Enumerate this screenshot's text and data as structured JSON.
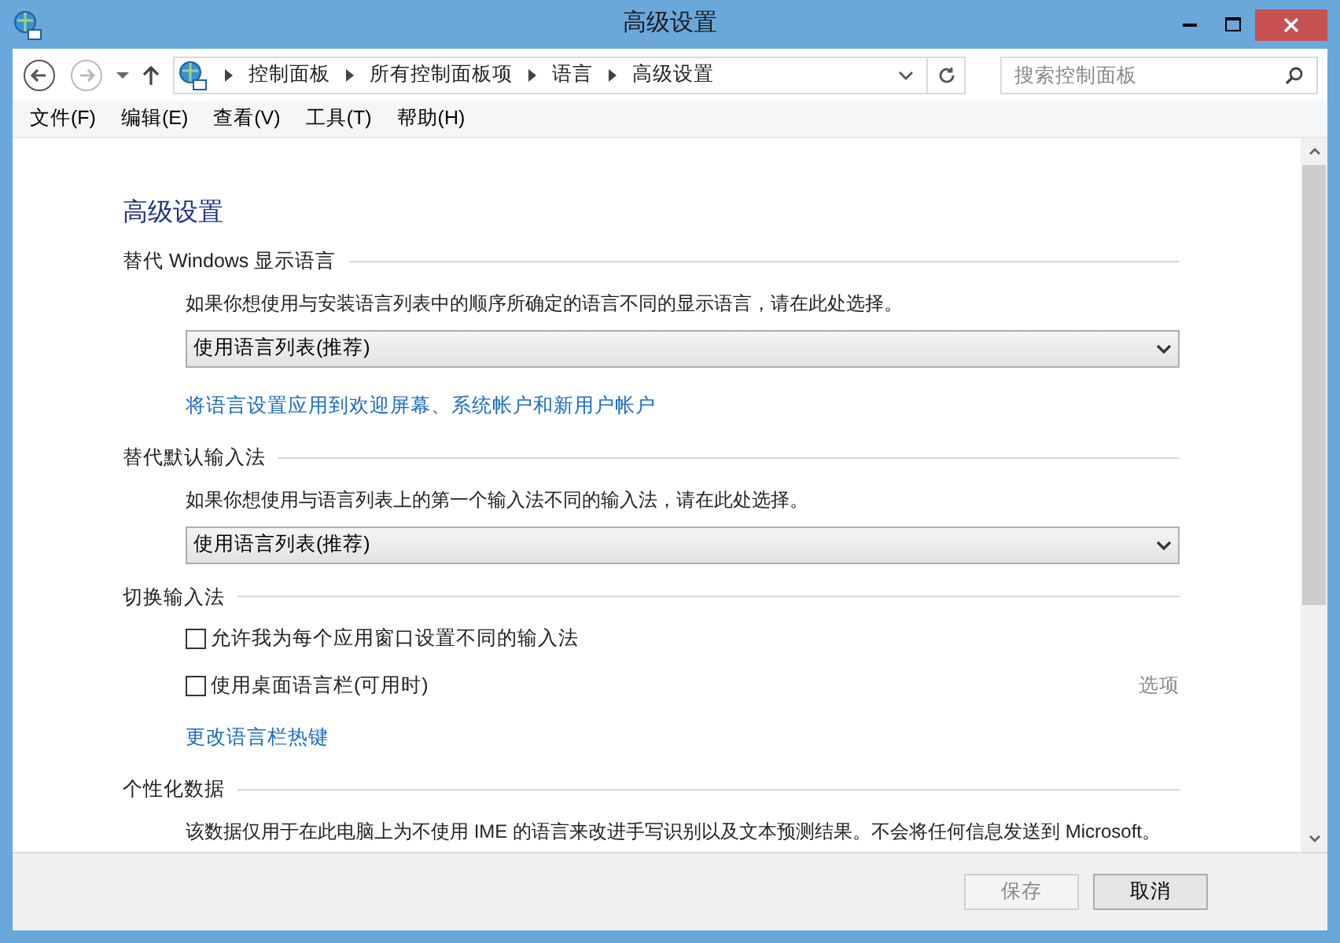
{
  "window": {
    "title": "高级设置"
  },
  "breadcrumb": [
    "控制面板",
    "所有控制面板项",
    "语言",
    "高级设置"
  ],
  "search": {
    "placeholder": "搜索控制面板"
  },
  "menu": [
    "文件(F)",
    "编辑(E)",
    "查看(V)",
    "工具(T)",
    "帮助(H)"
  ],
  "heading": "高级设置",
  "sections": [
    {
      "title": "替代 Windows 显示语言",
      "items": [
        {
          "kind": "text",
          "text": "如果你想使用与安装语言列表中的顺序所确定的语言不同的显示语言，请在此处选择。"
        },
        {
          "kind": "select",
          "value": "使用语言列表(推荐)"
        },
        {
          "kind": "link",
          "text": "将语言设置应用到欢迎屏幕、系统帐户和新用户帐户"
        }
      ]
    },
    {
      "title": "替代默认输入法",
      "items": [
        {
          "kind": "text",
          "text": "如果你想使用与语言列表上的第一个输入法不同的输入法，请在此处选择。"
        },
        {
          "kind": "select",
          "value": "使用语言列表(推荐)"
        }
      ]
    },
    {
      "title": "切换输入法",
      "items": [
        {
          "kind": "checkbox",
          "label": "允许我为每个应用窗口设置不同的输入法",
          "checked": false
        },
        {
          "kind": "checkbox",
          "label": "使用桌面语言栏(可用时)",
          "checked": false,
          "link": {
            "text": "选项",
            "disabled": true
          }
        },
        {
          "kind": "link",
          "text": "更改语言栏热键"
        }
      ]
    },
    {
      "title": "个性化数据",
      "items": [
        {
          "kind": "text",
          "text": "该数据仅用于在此电脑上为不使用 IME 的语言来改进手写识别以及文本预测结果。不会将任何信息发送到 Microsoft。"
        }
      ]
    }
  ],
  "buttons": [
    {
      "label": "保存",
      "disabled": true
    },
    {
      "label": "取消",
      "disabled": false
    }
  ]
}
